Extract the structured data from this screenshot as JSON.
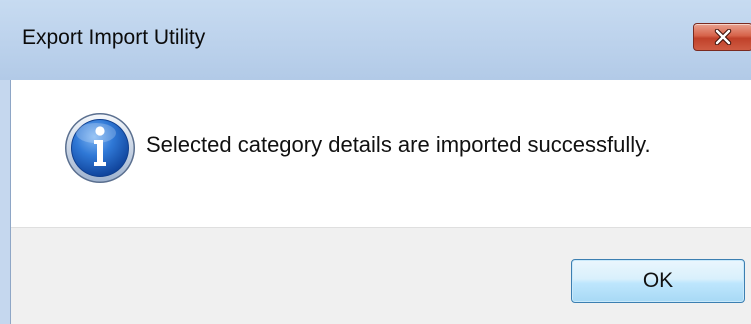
{
  "window": {
    "title": "Export Import Utility"
  },
  "dialog": {
    "icon": "information-icon",
    "message": "Selected category details are imported successfully.",
    "ok_label": "OK"
  },
  "colors": {
    "titlebar": "#bcd2ec",
    "close_button": "#c94c33",
    "button_area": "#f0f0f0",
    "ok_border": "#3c7fb1",
    "info_icon": "#1f5fbf"
  }
}
